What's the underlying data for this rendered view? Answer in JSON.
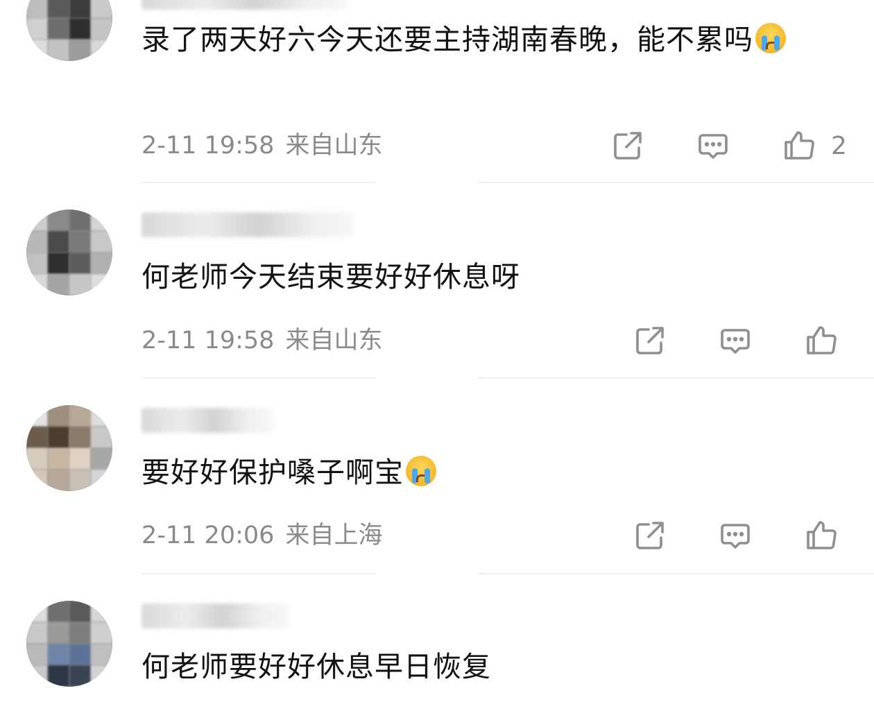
{
  "comments": [
    {
      "username": "",
      "text": "录了两天好六今天还要主持湖南春晚，能不累吗",
      "emoji": "crying-face-icon",
      "time": "2-11 19:58",
      "location": "来自山东",
      "like_count": "2"
    },
    {
      "username": "",
      "text": "何老师今天结束要好好休息呀",
      "emoji": "",
      "time": "2-11 19:58",
      "location": "来自山东",
      "like_count": ""
    },
    {
      "username": "",
      "text": "要好好保护嗓子啊宝",
      "emoji": "crying-face-icon",
      "time": "2-11 20:06",
      "location": "来自上海",
      "like_count": ""
    },
    {
      "username": "",
      "text": "何老师要好好休息早日恢复",
      "emoji": "",
      "time": "",
      "location": "",
      "like_count": ""
    }
  ],
  "icons": {
    "share": "share-icon",
    "reply": "comment-bubble-icon",
    "like": "thumbs-up-icon"
  },
  "colors": {
    "text": "#121212",
    "meta": "#8a8a8a",
    "icon": "#8f8f8f",
    "divider": "#eeeeee"
  }
}
